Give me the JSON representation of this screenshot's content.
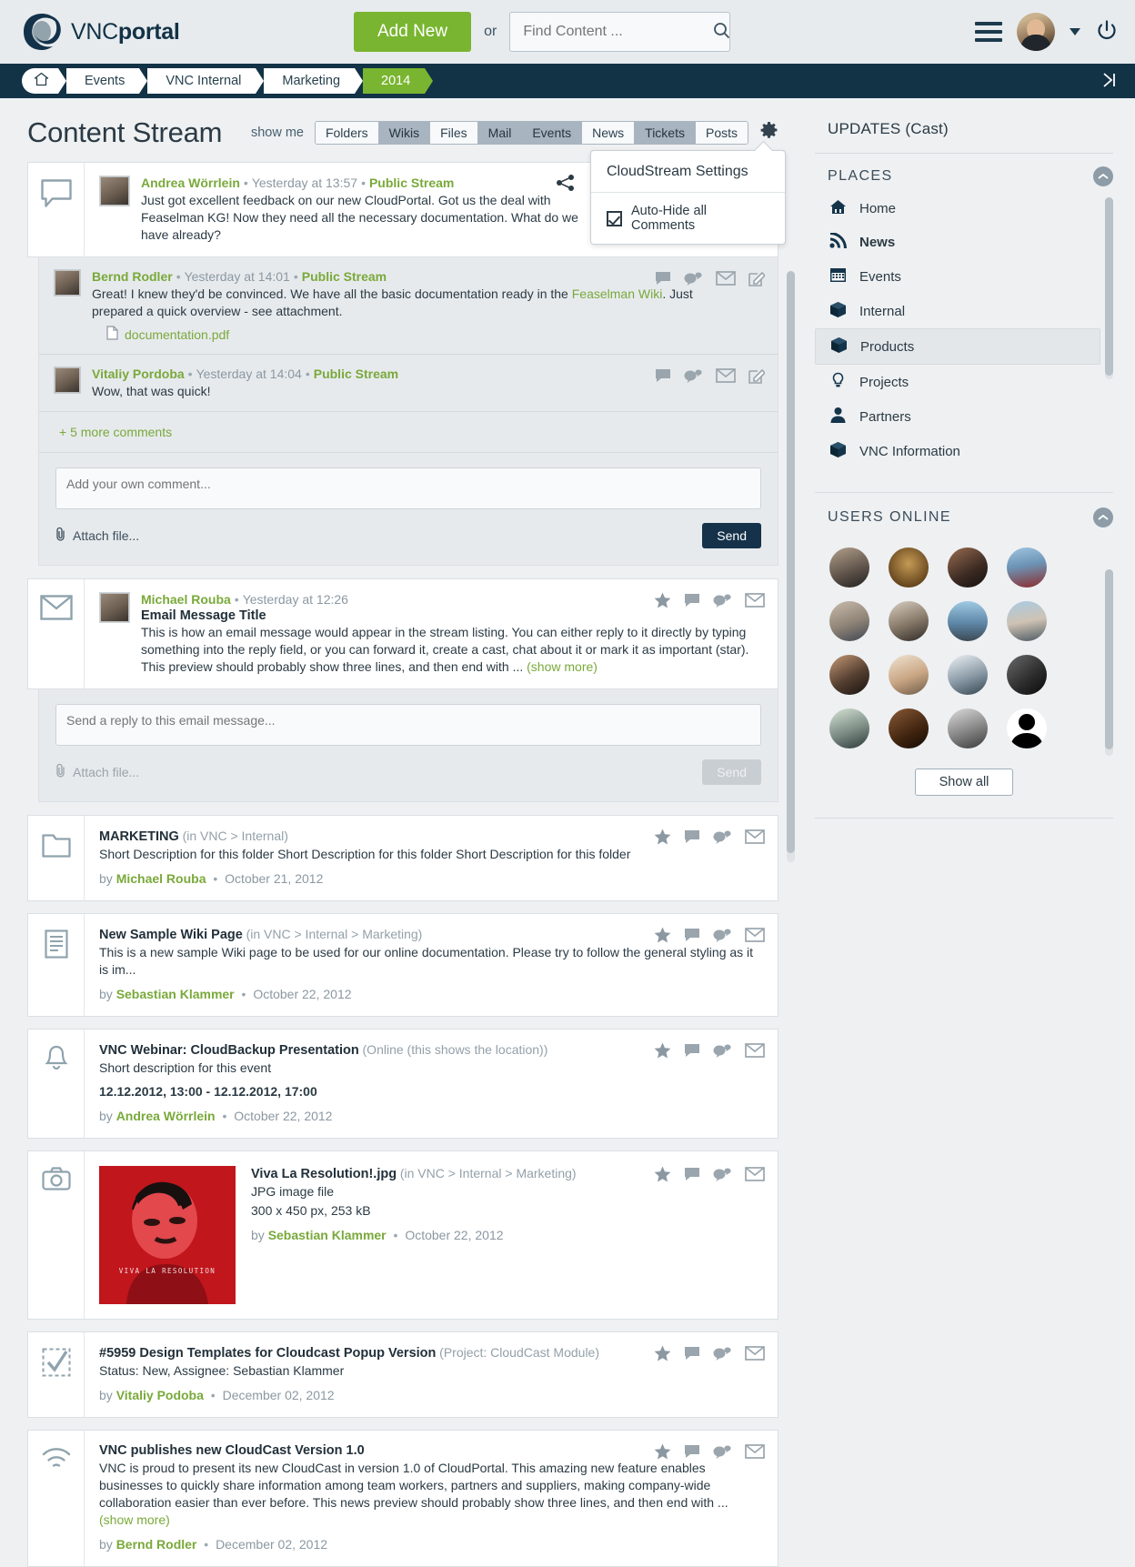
{
  "brand": {
    "name_light": "VNC",
    "name_bold": "portal",
    "logo_icon": "vnc-swirl-logo"
  },
  "header": {
    "add_new_label": "Add New",
    "or_label": "or",
    "search_placeholder": "Find Content ...",
    "search_value": "",
    "search_icon": "search-icon",
    "menu_icon": "hamburger-menu-icon",
    "user_caret_icon": "chevron-down-icon",
    "power_icon": "power-icon",
    "avatar_icon": "user-avatar"
  },
  "breadcrumb": {
    "home_icon": "home-icon",
    "items": [
      "Events",
      "VNC Internal",
      "Marketing"
    ],
    "active": "2014",
    "collapse_icon": "collapse-right-icon"
  },
  "page": {
    "title": "Content Stream"
  },
  "filters": {
    "label": "show me",
    "gear_icon": "gear-icon",
    "tabs": [
      {
        "label": "Folders",
        "selected": false
      },
      {
        "label": "Wikis",
        "selected": true
      },
      {
        "label": "Files",
        "selected": false
      },
      {
        "label": "Mail",
        "selected": true
      },
      {
        "label": "Events",
        "selected": true
      },
      {
        "label": "News",
        "selected": false
      },
      {
        "label": "Tickets",
        "selected": true
      },
      {
        "label": "Posts",
        "selected": false
      }
    ]
  },
  "settings_popover": {
    "title": "CloudStream Settings",
    "checkbox_label": "Auto-Hide all Comments",
    "checkbox_checked": true
  },
  "post": {
    "type_icon": "comment-bubble-icon",
    "author": "Andrea Wörrlein",
    "time": "Yesterday at 13:57",
    "stream": "Public Stream",
    "text": "Just got excellent feedback on our new CloudPortal. Got us the deal with Feaselman KG! Now they need all the necessary documentation. What do we have already?",
    "share_icon": "share-icon",
    "comments": [
      {
        "author": "Bernd Rodler",
        "time": "Yesterday at 14:01",
        "stream": "Public Stream",
        "text_before": "Great! I knew they'd be convinced. We have all the basic documentation ready in the ",
        "link": "Feaselman Wiki",
        "text_after": ". Just prepared a quick overview - see attachment.",
        "attachment": "documentation.pdf",
        "attachment_icon": "file-icon",
        "actions": [
          "comment-icon",
          "cast-icon",
          "mail-icon",
          "edit-icon"
        ]
      },
      {
        "author": "Vitaliy Pordoba",
        "time": "Yesterday at 14:04",
        "stream": "Public Stream",
        "text_before": "Wow, that was quick!",
        "link": "",
        "text_after": "",
        "attachment": "",
        "attachment_icon": "",
        "actions": [
          "comment-icon",
          "cast-icon",
          "mail-icon",
          "edit-icon"
        ]
      }
    ],
    "more_comments": "+ 5 more comments",
    "reply_placeholder": "Add your own comment...",
    "attach_label": "Attach file...",
    "attach_icon": "paperclip-icon",
    "send_label": "Send"
  },
  "email": {
    "type_icon": "envelope-icon",
    "author": "Michael Rouba",
    "time": "Yesterday at 12:26",
    "title": "Email Message Title",
    "text": "This is how an email message would appear in the stream listing. You can either reply to it directly by typing something into the reply field, or you can forward it, create a cast, chat about it or mark it as important (star). This preview should probably show three lines, and then end with ...",
    "show_more": "(show more)",
    "actions": [
      "star-icon",
      "comment-icon",
      "cast-icon",
      "mail-icon"
    ],
    "reply_placeholder": "Send a reply to this email message...",
    "attach_label": "Attach file...",
    "attach_icon": "paperclip-icon",
    "send_label": "Send"
  },
  "items": [
    {
      "type_icon": "folder-icon",
      "title": "MARKETING",
      "location": "(in VNC > Internal)",
      "desc": "Short Description for this folder Short Description for this folder Short Description for this folder",
      "by_label": "by",
      "author": "Michael Rouba",
      "date": "October 21, 2012",
      "extra": "",
      "extra2": "",
      "actions": [
        "star-icon",
        "comment-icon",
        "cast-icon",
        "mail-icon"
      ]
    },
    {
      "type_icon": "wiki-page-icon",
      "title": "New Sample Wiki Page",
      "location": "(in VNC > Internal > Marketing)",
      "desc": "This is a new sample Wiki page to be used for our online documentation. Please try to follow the general styling as it is im...",
      "by_label": "by",
      "author": "Sebastian Klammer",
      "date": "October 22, 2012",
      "extra": "",
      "extra2": "",
      "actions": [
        "star-icon",
        "comment-icon",
        "cast-icon",
        "mail-icon"
      ]
    },
    {
      "type_icon": "bell-icon",
      "title": "VNC Webinar: CloudBackup Presentation",
      "location": "(Online (this shows the location))",
      "desc": "Short description for this event",
      "by_label": "by",
      "author": "Andrea Wörrlein",
      "date": "October 22, 2012",
      "extra": "12.12.2012, 13:00 - 12.12.2012, 17:00",
      "extra2": "",
      "actions": [
        "star-icon",
        "comment-icon",
        "cast-icon",
        "mail-icon"
      ]
    },
    {
      "type_icon": "camera-icon",
      "title": "Viva La Resolution!.jpg",
      "location": "(in VNC > Internal > Marketing)",
      "desc": "JPG image file",
      "by_label": "by",
      "author": "Sebastian Klammer",
      "date": "October 22, 2012",
      "extra": "300 x 450 px, 253 kB",
      "extra2": "VIVA LA RESOLUTION",
      "actions": [
        "star-icon",
        "comment-icon",
        "cast-icon",
        "mail-icon"
      ]
    },
    {
      "type_icon": "ticket-check-icon",
      "title": "#5959 Design Templates for Cloudcast Popup Version",
      "location": "(Project: CloudCast Module)",
      "desc": "Status: New, Assignee: Sebastian Klammer",
      "by_label": "by",
      "author": "Vitaliy Podoba",
      "date": "December 02, 2012",
      "extra": "",
      "extra2": "",
      "actions": [
        "star-icon",
        "comment-icon",
        "cast-icon",
        "mail-icon"
      ]
    },
    {
      "type_icon": "rss-news-icon",
      "title": "VNC publishes new CloudCast Version 1.0",
      "location": "",
      "desc": "VNC is proud to present its new CloudCast in version 1.0 of CloudPortal. This amazing new feature enables businesses to quickly share information among team workers, partners and suppliers, making company-wide collaboration easier than ever before. This news preview should probably show three lines, and then end with ...",
      "show_more": "(show more)",
      "by_label": "by",
      "author": "Bernd Rodler",
      "date": "December 02, 2012",
      "extra": "",
      "extra2": "",
      "actions": [
        "star-icon",
        "comment-icon",
        "cast-icon",
        "mail-icon"
      ]
    }
  ],
  "sidebar": {
    "updates_title": "UPDATES (Cast)",
    "places_title": "PLACES",
    "places_collapse_icon": "chevron-up-icon",
    "places": [
      {
        "label": "Home",
        "icon": "home-icon",
        "selected": false,
        "bold": false
      },
      {
        "label": "News",
        "icon": "rss-icon",
        "selected": false,
        "bold": true
      },
      {
        "label": "Events",
        "icon": "calendar-icon",
        "selected": false,
        "bold": false
      },
      {
        "label": "Internal",
        "icon": "box-icon",
        "selected": false,
        "bold": false
      },
      {
        "label": "Products",
        "icon": "box-icon",
        "selected": true,
        "bold": false
      },
      {
        "label": "Projects",
        "icon": "bulb-icon",
        "selected": false,
        "bold": false
      },
      {
        "label": "Partners",
        "icon": "person-icon",
        "selected": false,
        "bold": false
      },
      {
        "label": "VNC Information",
        "icon": "box-icon",
        "selected": false,
        "bold": false
      }
    ],
    "users_title": "USERS ONLINE",
    "users_collapse_icon": "chevron-up-icon",
    "users_count": 16,
    "show_all_label": "Show all"
  },
  "colors": {
    "brand_green": "#79b530",
    "link_green": "#79a93a",
    "navy": "#123246",
    "page_bg": "#eef0f2",
    "card_bg": "#ffffff",
    "muted": "#8b98a2"
  }
}
